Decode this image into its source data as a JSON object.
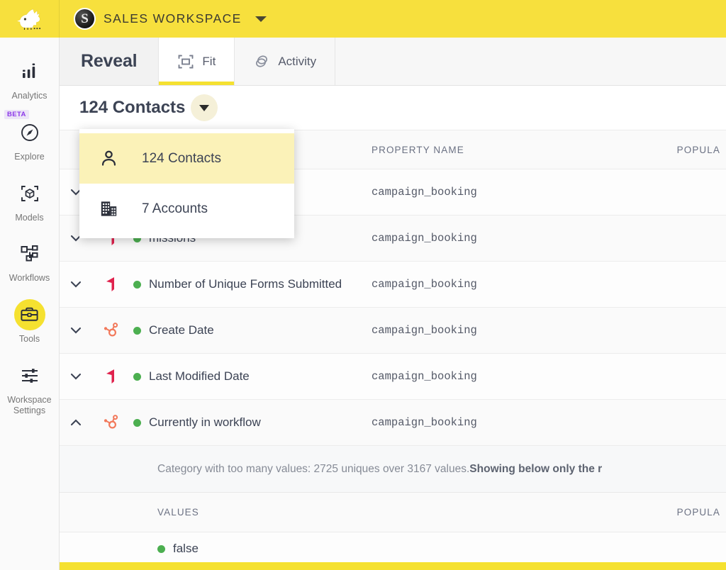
{
  "topbar": {
    "logo_icon": "bird-logo-icon",
    "workspace_initial": "S",
    "workspace_name": "SALES WORKSPACE",
    "workspace_caret_icon": "chevron-down-icon",
    "background_color": "#f7e03d"
  },
  "sidebar": {
    "items": [
      {
        "label": "Analytics",
        "icon": "bar-chart-icon",
        "active": false,
        "badge": ""
      },
      {
        "label": "Explore",
        "icon": "compass-icon",
        "active": false,
        "badge": "BETA"
      },
      {
        "label": "Models",
        "icon": "cube-scan-icon",
        "active": false,
        "badge": ""
      },
      {
        "label": "Workflows",
        "icon": "workflow-nodes-icon",
        "active": false,
        "badge": ""
      },
      {
        "label": "Tools",
        "icon": "toolbox-icon",
        "active": true,
        "badge": ""
      },
      {
        "label": "Workspace Settings",
        "icon": "sliders-icon",
        "active": false,
        "badge": ""
      }
    ],
    "active_color": "#f5e130",
    "beta_color": "#8b38e8"
  },
  "tabs": [
    {
      "label": "Reveal",
      "icon": "",
      "active": false,
      "brand": true
    },
    {
      "label": "Fit",
      "icon": "fit-frame-icon",
      "active": true,
      "brand": false
    },
    {
      "label": "Activity",
      "icon": "stacked-rings-icon",
      "active": false,
      "brand": false
    }
  ],
  "entity_selector": {
    "current": "124 Contacts",
    "caret_icon": "chevron-down-icon",
    "open": true,
    "options": [
      {
        "label": "124 Contacts",
        "icon": "person-icon",
        "selected": true
      },
      {
        "label": "7 Accounts",
        "icon": "building-icon",
        "selected": false
      }
    ]
  },
  "table": {
    "headers": {
      "property_name": "PROPERTY NAME",
      "population": "POPULA"
    },
    "rows": [
      {
        "expanded": false,
        "source_icon": "marketo-icon",
        "dot": "#4caf50",
        "name": "",
        "property_name": "campaign_booking",
        "population": ""
      },
      {
        "expanded": false,
        "source_icon": "marketo-icon",
        "dot": "#4caf50",
        "name": "missions",
        "property_name": "campaign_booking",
        "population": ""
      },
      {
        "expanded": false,
        "source_icon": "marketo-icon",
        "dot": "#4caf50",
        "name": "Number of Unique Forms Submitted",
        "property_name": "campaign_booking",
        "population": ""
      },
      {
        "expanded": false,
        "source_icon": "hubspot-icon",
        "dot": "#4caf50",
        "name": "Create Date",
        "property_name": "campaign_booking",
        "population": ""
      },
      {
        "expanded": false,
        "source_icon": "marketo-icon",
        "dot": "#4caf50",
        "name": "Last Modified Date",
        "property_name": "campaign_booking",
        "population": ""
      },
      {
        "expanded": true,
        "source_icon": "hubspot-icon",
        "dot": "#4caf50",
        "name": "Currently in workflow",
        "property_name": "campaign_booking",
        "population": ""
      }
    ]
  },
  "info_banner": {
    "text_plain": "Category with too many values: 2725 uniques over 3167 values. ",
    "text_bold": "Showing below only the r",
    "uniques": 2725,
    "total_values": 3167
  },
  "values_section": {
    "headers": {
      "values": "VALUES",
      "population": "POPULA"
    },
    "rows": [
      {
        "dot": "#4caf50",
        "label": "false",
        "population": ""
      }
    ]
  },
  "colors": {
    "brand_yellow": "#f5e130",
    "topbar_yellow": "#f7e03d",
    "green_dot": "#4caf50",
    "hubspot_orange": "#f2795b",
    "marketo_red": "#e0224d",
    "text_dark": "#3c4354",
    "text_muted": "#6b7183"
  }
}
